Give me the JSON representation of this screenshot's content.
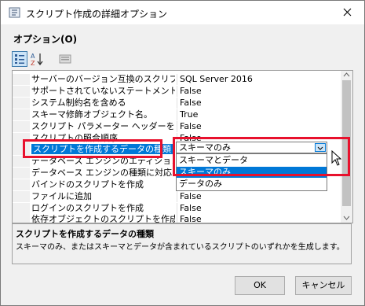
{
  "window": {
    "title": "スクリプト作成の詳細オプション",
    "close_label": "✕"
  },
  "options_label": "オプション(O)",
  "toolbar": {
    "categorized_icon": "categorized-icon",
    "alpha_icon": "alphabetical-sort-icon",
    "pages_icon": "property-pages-icon"
  },
  "properties": [
    {
      "name": "サーバーのバージョン互換のスクリプト",
      "value": "SQL Server 2016"
    },
    {
      "name": "サポートされていないステートメントを含む",
      "value": "False"
    },
    {
      "name": "システム制約名を含める",
      "value": "False"
    },
    {
      "name": "スキーマ修飾オブジェクト名。",
      "value": "True"
    },
    {
      "name": "スクリプト パラメーター ヘッダーを含める",
      "value": "False"
    },
    {
      "name": "スクリプトの照合順序",
      "value": "False"
    },
    {
      "name": "スクリプトを作成するデータの種類",
      "value": "スキーマのみ"
    },
    {
      "name": "データベース エンジンのエディションのスクリプト",
      "value": ""
    },
    {
      "name": "データベース エンジンの種類に対応したスクリプト",
      "value": ""
    },
    {
      "name": "バインドのスクリプトを作成",
      "value": ""
    },
    {
      "name": "ファイルに追加",
      "value": "False"
    },
    {
      "name": "ログインのスクリプトを作成",
      "value": "False"
    },
    {
      "name": "依存オブジェクトのスクリプトを作成します",
      "value": "False"
    }
  ],
  "dropdown": {
    "selected": "スキーマのみ",
    "options": [
      "スキーマとデータ",
      "スキーマのみ",
      "データのみ"
    ],
    "highlighted_index": 1
  },
  "description": {
    "title": "スクリプトを作成するデータの種類",
    "text": "スキーマのみ、またはスキーマとデータが含まれているスクリプトのいずれかを生成します。"
  },
  "buttons": {
    "ok": "OK",
    "cancel": "キャンセル"
  },
  "colors": {
    "highlight": "#0078d7",
    "annotation_red": "#e8112d"
  }
}
